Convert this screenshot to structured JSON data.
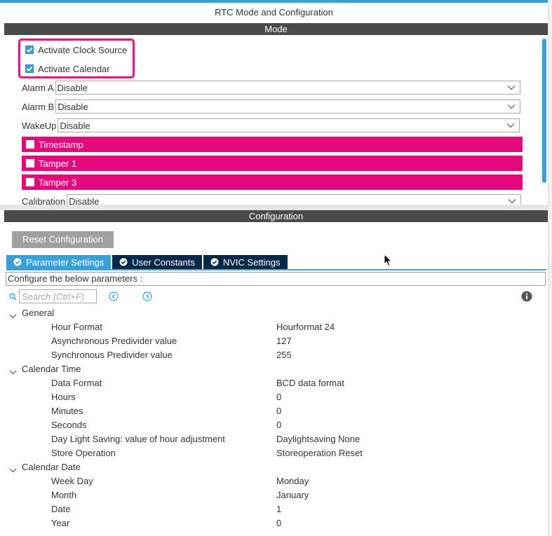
{
  "window": {
    "title": "RTC Mode and Configuration"
  },
  "mode": {
    "header": "Mode",
    "activate_clock_source": {
      "label": "Activate Clock Source",
      "checked": true
    },
    "activate_calendar": {
      "label": "Activate Calendar",
      "checked": true
    },
    "alarm_a": {
      "label": "Alarm A",
      "value": "Disable"
    },
    "alarm_b": {
      "label": "Alarm B",
      "value": "Disable"
    },
    "wakeup": {
      "label": "WakeUp",
      "value": "Disable"
    },
    "timestamp": {
      "label": "Timestamp",
      "checked": false
    },
    "tamper1": {
      "label": "Tamper 1",
      "checked": false
    },
    "tamper3": {
      "label": "Tamper 3",
      "checked": false
    },
    "calibration": {
      "label": "Calibration",
      "value": "Disable"
    },
    "highlight_color": "#e4097c"
  },
  "configuration": {
    "header": "Configuration",
    "reset_label": "Reset Configuration",
    "tabs": [
      {
        "label": "Parameter Settings",
        "active": true
      },
      {
        "label": "User Constants",
        "active": false
      },
      {
        "label": "NVIC Settings",
        "active": false
      }
    ],
    "caption": "Configure the below parameters :",
    "search_placeholder": "Search (Ctrl+F)",
    "groups": [
      {
        "name": "General",
        "params": [
          {
            "name": "Hour Format",
            "value": "Hourformat 24"
          },
          {
            "name": "Asynchronous Predivider value",
            "value": "127"
          },
          {
            "name": "Synchronous Predivider value",
            "value": "255"
          }
        ]
      },
      {
        "name": "Calendar Time",
        "params": [
          {
            "name": "Data Format",
            "value": "BCD data format"
          },
          {
            "name": "Hours",
            "value": "0"
          },
          {
            "name": "Minutes",
            "value": "0"
          },
          {
            "name": "Seconds",
            "value": "0"
          },
          {
            "name": "Day Light Saving: value of hour adjustment",
            "value": "Daylightsaving None"
          },
          {
            "name": "Store Operation",
            "value": "Storeoperation Reset"
          }
        ]
      },
      {
        "name": "Calendar Date",
        "params": [
          {
            "name": "Week Day",
            "value": "Monday"
          },
          {
            "name": "Month",
            "value": "January"
          },
          {
            "name": "Date",
            "value": "1"
          },
          {
            "name": "Year",
            "value": "0"
          }
        ]
      }
    ],
    "accent_color": "#3aa1d6",
    "tab_inactive_color": "#06294a"
  }
}
